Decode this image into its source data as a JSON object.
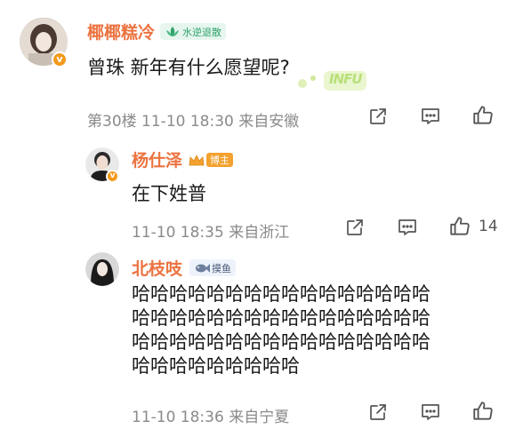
{
  "comment1": {
    "username": "椰椰糕冷",
    "badge": "水逆退散",
    "text": "曾珠 新年有什么愿望呢?",
    "watermark": "INFU",
    "floor": "第30楼",
    "time": "11-10 18:30",
    "location": "来自安徽"
  },
  "reply1": {
    "username": "杨仕泽",
    "badge": "博主",
    "text": "在下姓普",
    "time": "11-10 18:35",
    "location": "来自浙江",
    "like_count": "14"
  },
  "reply2": {
    "username": "北枝吱",
    "badge": "摸鱼",
    "lines": [
      "哈哈哈哈哈哈哈哈哈哈哈哈哈哈哈哈",
      "哈哈哈哈哈哈哈哈哈哈哈哈哈哈哈哈",
      "哈哈哈哈哈哈哈哈哈哈哈哈哈哈哈哈",
      "哈哈哈哈哈哈哈哈哈"
    ],
    "time": "11-10 18:36",
    "location": "来自宁夏"
  },
  "colors": {
    "username": "#eb7340",
    "meta": "#8a8a8a",
    "badge_green_bg": "#e6f6ee",
    "badge_blog": "#f3a12f"
  }
}
